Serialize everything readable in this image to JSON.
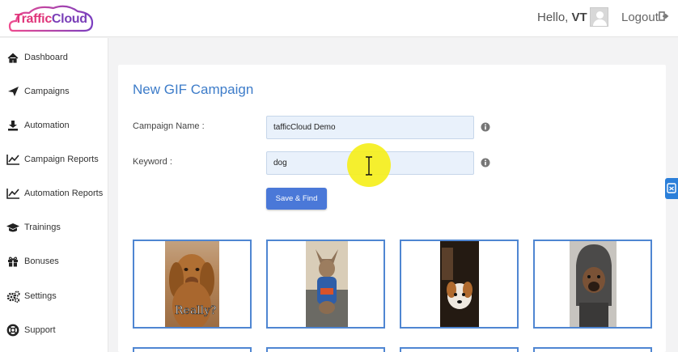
{
  "header": {
    "logo_text_1": "Traffic",
    "logo_text_2": "Cloud",
    "greeting": "Hello,",
    "username": "VT",
    "logout_label": "Logout"
  },
  "sidebar": {
    "items": [
      {
        "label": "Dashboard",
        "icon": "home-icon"
      },
      {
        "label": "Campaigns",
        "icon": "paper-plane-icon"
      },
      {
        "label": "Automation",
        "icon": "download-icon"
      },
      {
        "label": "Campaign Reports",
        "icon": "line-chart-icon"
      },
      {
        "label": "Automation Reports",
        "icon": "line-chart-icon"
      },
      {
        "label": "Trainings",
        "icon": "graduation-cap-icon"
      },
      {
        "label": "Bonuses",
        "icon": "gift-icon"
      },
      {
        "label": "Settings",
        "icon": "gears-icon"
      },
      {
        "label": "Support",
        "icon": "life-ring-icon"
      }
    ]
  },
  "main": {
    "title": "New GIF Campaign",
    "campaign_name_label": "Campaign Name :",
    "campaign_name_value": "tafficCloud Demo",
    "keyword_label": "Keyword :",
    "keyword_value": "dog",
    "save_button_label": "Save & Find",
    "gif_overlay_text": "Really?"
  },
  "colors": {
    "accent": "#3d7cc9",
    "button": "#4a78d8",
    "card_border": "#4f86d2",
    "logo_pink": "#e0357a",
    "logo_purple": "#7a3fb8",
    "cursor_highlight": "#f5ef1c"
  }
}
